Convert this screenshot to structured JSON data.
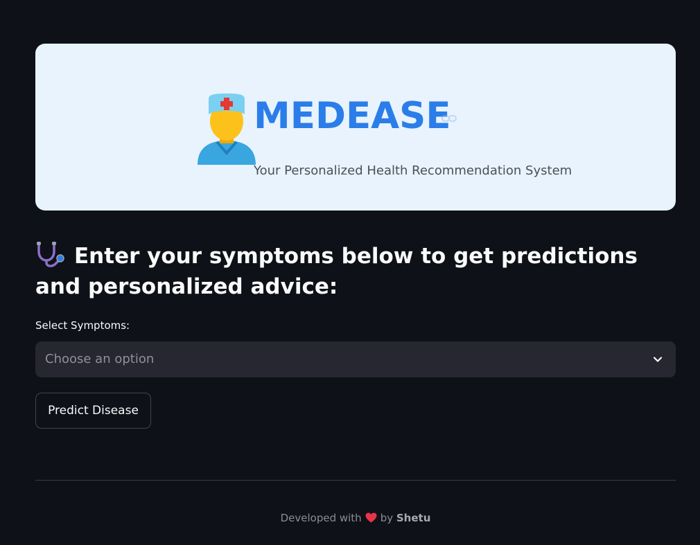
{
  "hero": {
    "title": "MEDEASE",
    "subtitle": "Your Personalized Health Recommendation System",
    "icon": "health-worker-icon",
    "title_color": "#2b7de9",
    "background": "#e8f3fd"
  },
  "main": {
    "heading": "Enter your symptoms below to get predictions and personalized advice:",
    "heading_icon": "stethoscope-icon"
  },
  "symptoms": {
    "label": "Select Symptoms:",
    "placeholder": "Choose an option"
  },
  "actions": {
    "predict_label": "Predict Disease"
  },
  "footer": {
    "prefix": "Developed with",
    "icon": "heart-icon",
    "by": "by",
    "author": "Shetu"
  },
  "colors": {
    "background": "#0e1117",
    "select_background": "#262730",
    "text": "#fafafa",
    "heart": "#e8344a"
  }
}
